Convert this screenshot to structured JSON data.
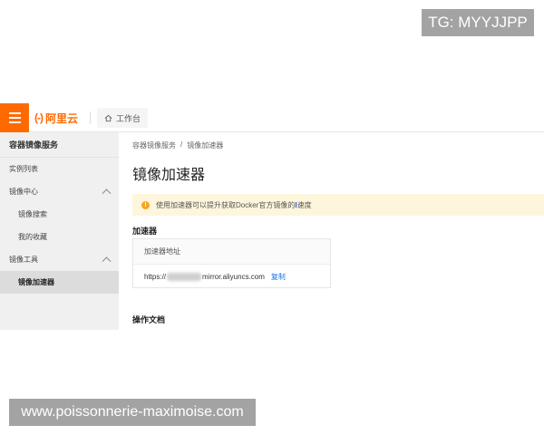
{
  "overlays": {
    "tg_label": "TG: MYYJJPP",
    "site_label": "www.poissonnerie-maximoise.com"
  },
  "topbar": {
    "menu_icon": "hamburger-icon",
    "logo_mark": "(-)",
    "logo_text": "阿里云",
    "workbench_label": "工作台",
    "workbench_icon": "home-icon",
    "accent_color": "#ff6a00"
  },
  "sidebar": {
    "title": "容器镜像服务",
    "items": [
      {
        "label": "实例列表"
      },
      {
        "label": "镜像中心"
      },
      {
        "label": "镜像搜索"
      },
      {
        "label": "我的收藏"
      },
      {
        "label": "镜像工具"
      },
      {
        "label": "镜像加速器"
      }
    ]
  },
  "main": {
    "breadcrumb": [
      "容器镜像服务",
      "/",
      "镜像加速器"
    ],
    "title": "镜像加速器",
    "notice": {
      "icon": "warning-icon",
      "text_before": "使用加速器可以提升获取Docker官方镜像的",
      "text_after": "速度"
    },
    "accelerator": {
      "section_title": "加速器",
      "column_header": "加速器地址",
      "url_prefix": "https://",
      "url_suffix": "mirror.aliyuncs.com",
      "copy_label": "复制"
    },
    "docs_section_title": "操作文档"
  }
}
